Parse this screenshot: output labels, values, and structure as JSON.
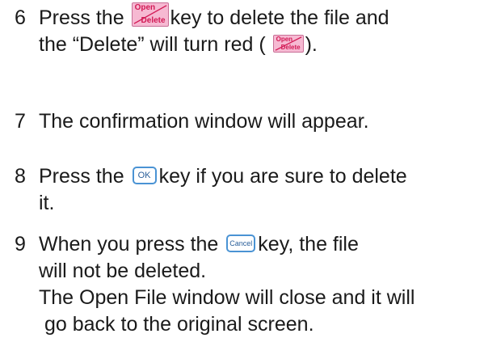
{
  "colors": {
    "delete_key_bg": "#f6b9d2",
    "delete_key_text": "#d21a55",
    "blue_key_border": "#4a93d4"
  },
  "keys": {
    "open_delete": {
      "top": "Open",
      "bottom": "Delete"
    },
    "ok": "OK",
    "cancel": "Cancel"
  },
  "steps": [
    {
      "number": "6",
      "line1_before": "Press the",
      "line1_after": "key to delete the file and",
      "line2_before": "the “Delete” will turn red (",
      "line2_after": ")."
    },
    {
      "number": "7",
      "line1": "The confirmation window will appear."
    },
    {
      "number": "8",
      "line1_before": "Press the",
      "line1_after": "key if you are sure to delete",
      "line2": "it."
    },
    {
      "number": "9",
      "line1_before": "When you press the",
      "line1_after": "key, the file",
      "line2": "will not be deleted.",
      "line3": "The Open File window will close and it will",
      "line4": "go back to the original screen."
    }
  ]
}
